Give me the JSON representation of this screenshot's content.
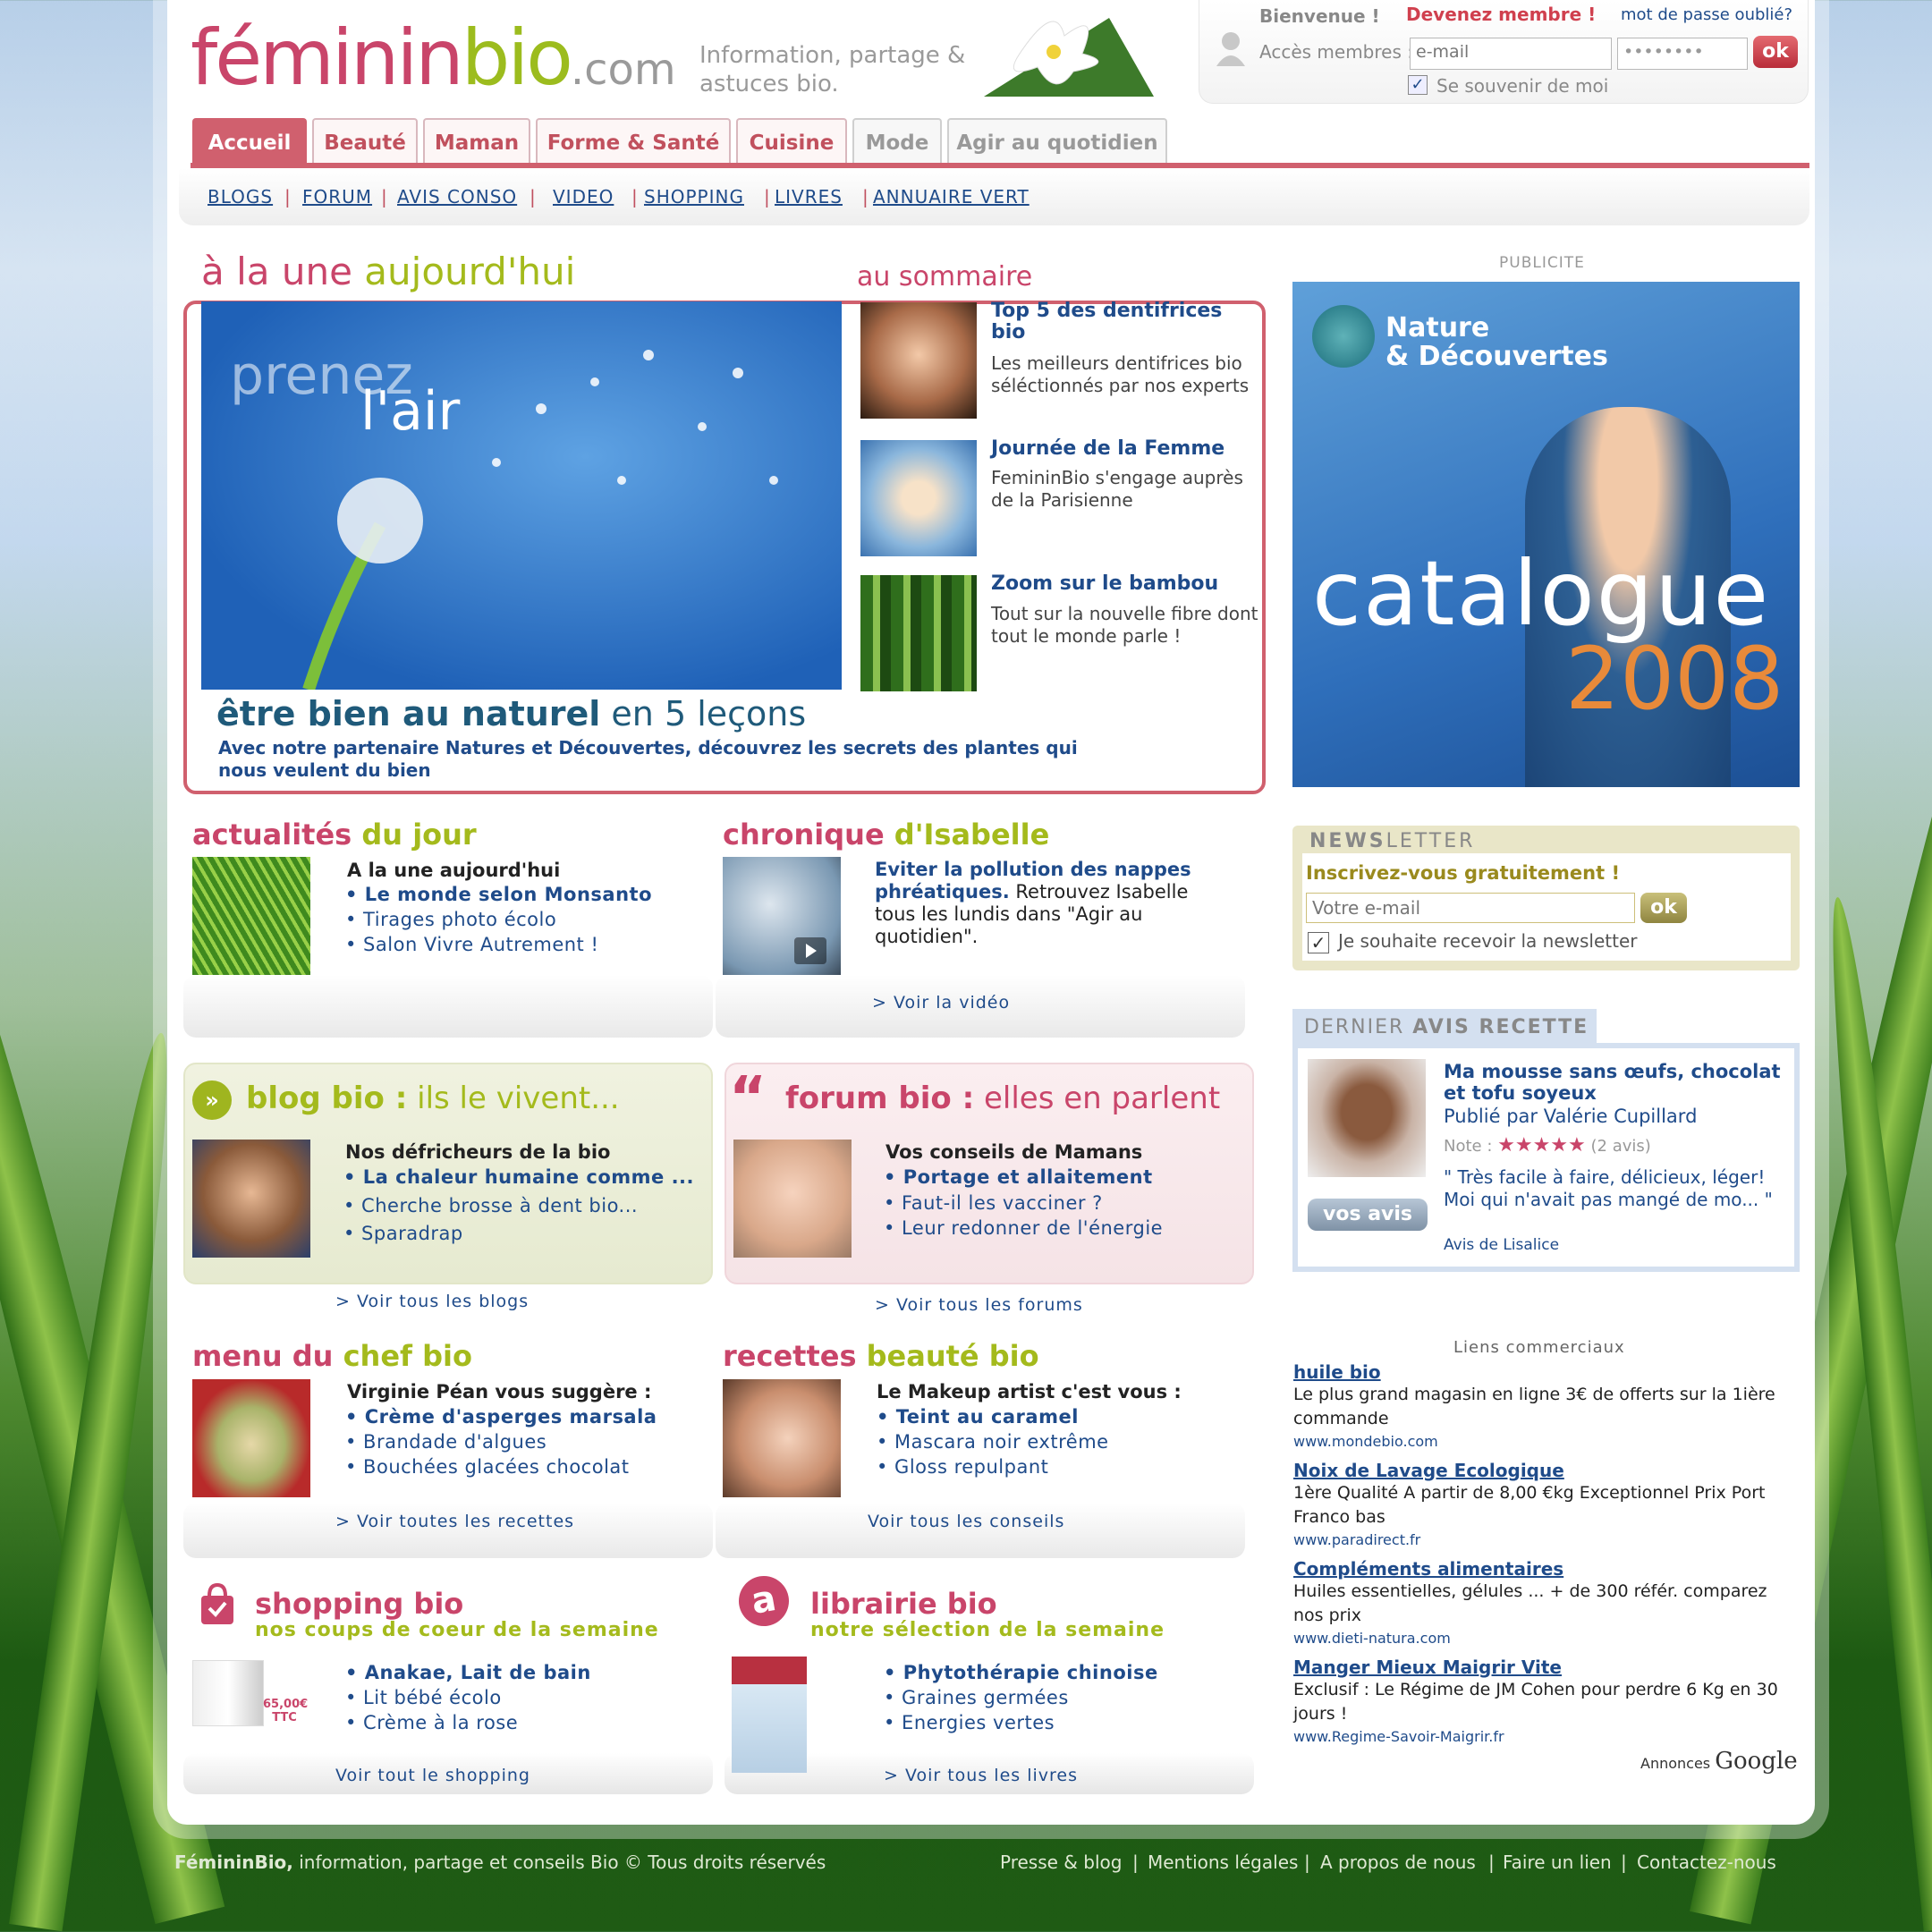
{
  "brand": {
    "logo_a": "féminin",
    "logo_b": "bio",
    "logo_c": ".com",
    "tagline": "Information, partage & astuces bio."
  },
  "login": {
    "welcome": "Bienvenue !",
    "become_member": "Devenez membre !",
    "forgot": "mot de passe oublié?",
    "members_label": "Accès membres :",
    "email_placeholder": "e-mail",
    "password_value": "••••••••",
    "ok": "ok",
    "remember": "Se souvenir de moi"
  },
  "tabs": [
    "Accueil",
    "Beauté",
    "Maman",
    "Forme & Santé",
    "Cuisine",
    "Mode",
    "Agir au quotidien"
  ],
  "subnav": [
    "BLOGS",
    "FORUM",
    "AVIS CONSO",
    "VIDEO",
    "SHOPPING",
    "LIVRES",
    "ANNUAIRE VERT"
  ],
  "une": {
    "title_a": "à la une",
    "title_b": "aujourd'hui",
    "image_text_a": "prenez",
    "image_text_b": "l'air",
    "headline_a": "être bien au naturel",
    "headline_b": " en 5 leçons",
    "text": "Avec notre partenaire Natures et Découvertes, découvrez les secrets des plantes qui nous veulent du bien"
  },
  "sommaire": {
    "title": "au sommaire",
    "items": [
      {
        "title": "Top 5 des dentifrices bio",
        "desc": "Les meilleurs dentifrices bio séléctionnés par nos experts"
      },
      {
        "title": "Journée de la Femme",
        "desc": "FemininBio s'engage auprès de la Parisienne"
      },
      {
        "title": "Zoom sur le bambou",
        "desc": "Tout sur la nouvelle fibre dont tout le monde parle !"
      }
    ]
  },
  "actu": {
    "title_a": "actualités",
    "title_b": "du jour",
    "heading": "A la une aujourd'hui",
    "items": [
      "• Le monde selon Monsanto",
      "• Tirages photo écolo",
      "• Salon Vivre Autrement !"
    ]
  },
  "chronique": {
    "title_a": "chronique",
    "title_b": "d'Isabelle",
    "link": "Eviter la pollution des nappes phréatiques.",
    "text": " Retrouvez Isabelle tous les lundis dans \"Agir au quotidien\".",
    "more": "> Voir la vidéo"
  },
  "blog": {
    "title_a": "blog bio :",
    "title_b": " ils le vivent...",
    "heading": "Nos défricheurs de la bio",
    "items": [
      "• La chaleur humaine comme ...",
      "• Cherche brosse à dent bio...",
      "• Sparadrap"
    ],
    "more": "> Voir tous les blogs"
  },
  "forum": {
    "title_a": "forum bio :",
    "title_b": " elles en parlent",
    "heading": "Vos conseils de Mamans",
    "items": [
      "• Portage et allaitement",
      "• Faut-il les vacciner ?",
      "• Leur redonner de l'énergie"
    ],
    "more": "> Voir tous les forums"
  },
  "menu_chef": {
    "title_a": "menu du",
    "title_b": " chef bio",
    "heading": "Virginie Péan vous suggère :",
    "items": [
      "• Crème d'asperges marsala",
      "• Brandade d'algues",
      "• Bouchées glacées chocolat"
    ],
    "more": "> Voir toutes les recettes"
  },
  "beaute": {
    "title_a": "recettes",
    "title_b": " beauté bio",
    "heading": "Le Makeup artist c'est vous :",
    "items": [
      "• Teint au caramel",
      "• Mascara noir extrême",
      "• Gloss repulpant"
    ],
    "more": "Voir tous les conseils"
  },
  "shopping": {
    "title": "shopping bio",
    "subtitle": "nos coups de coeur de la semaine",
    "price": "65,00€ TTC",
    "items": [
      "• Anakae, Lait de bain",
      "• Lit bébé écolo",
      "• Crème à la rose"
    ],
    "more": "Voir tout le shopping"
  },
  "librairie": {
    "title": "librairie bio",
    "subtitle": "notre sélection de la semaine",
    "items": [
      "• Phytothérapie chinoise",
      "• Graines germées",
      "• Energies vertes"
    ],
    "more": "> Voir tous les livres"
  },
  "pub": {
    "label": "PUBLICITE",
    "brand_a": "Nature",
    "brand_b": "& Découvertes",
    "word": "catalogue",
    "year": "2008"
  },
  "newsletter": {
    "title_a": "NEWS",
    "title_b": "LETTER",
    "cta": "Inscrivez-vous gratuitement !",
    "placeholder": "Votre e-mail",
    "ok": "ok",
    "checkbox": "Je souhaite recevoir la newsletter"
  },
  "avis": {
    "title_a": "DERNIER ",
    "title_b": "AVIS RECETTE",
    "recipe": "Ma mousse sans œufs, chocolat et tofu soyeux",
    "author": "Publié par Valérie Cupillard",
    "note_label": "Note :",
    "stars": "★★★★★",
    "count": "(2 avis)",
    "quote": "\" Très facile à faire, délicieux, léger! Moi qui n'avait pas mangé de mo... \"",
    "by": "Avis de Lisalice",
    "button": "vos avis"
  },
  "ads": {
    "title": "Liens commerciaux",
    "items": [
      {
        "h": "huile bio",
        "t": "Le plus grand magasin en ligne 3€ de offerts sur la 1ière commande",
        "u": "www.mondebio.com"
      },
      {
        "h": "Noix de Lavage Ecologique",
        "t": "1ère Qualité A partir de 8,00 €kg Exceptionnel Prix Port Franco bas",
        "u": "www.paradirect.fr"
      },
      {
        "h": "Compléments alimentaires",
        "t": "Huiles essentielles, gélules ... + de 300 référ. comparez nos prix",
        "u": "www.dieti-natura.com"
      },
      {
        "h": "Manger Mieux Maigrir Vite",
        "t": "Exclusif : Le Régime de JM Cohen pour perdre 6 Kg en 30 jours !",
        "u": "www.Regime-Savoir-Maigrir.fr"
      }
    ],
    "annonces": "Annonces",
    "google": "Google"
  },
  "footer": {
    "brand": "FémininBio,",
    "text": " information, partage et conseils Bio © Tous droits réservés",
    "links": [
      "Presse & blog",
      "Mentions légales",
      "A propos de nous",
      "Faire un lien",
      "Contactez-nous"
    ]
  }
}
